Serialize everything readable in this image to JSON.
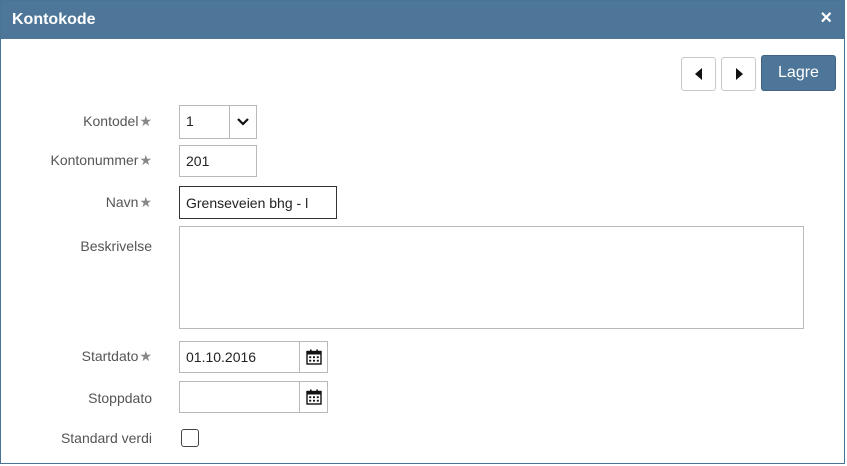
{
  "dialog": {
    "title": "Kontokode",
    "close_glyph": "×"
  },
  "toolbar": {
    "prev_icon": "caret-left-icon",
    "next_icon": "caret-right-icon",
    "save_label": "Lagre"
  },
  "form": {
    "required_glyph": "★",
    "kontodel": {
      "label": "Kontodel",
      "value": "1"
    },
    "kontonummer": {
      "label": "Kontonummer",
      "value": "201"
    },
    "navn": {
      "label": "Navn",
      "value": "Grenseveien bhg - l"
    },
    "beskrivelse": {
      "label": "Beskrivelse",
      "value": ""
    },
    "startdato": {
      "label": "Startdato",
      "value": "01.10.2016"
    },
    "stoppdato": {
      "label": "Stoppdato",
      "value": ""
    },
    "standard_verdi": {
      "label": "Standard verdi",
      "checked": false
    }
  },
  "colors": {
    "header": "#4d7698",
    "accent_button": "#4d7698",
    "border": "#b9b9b9"
  }
}
